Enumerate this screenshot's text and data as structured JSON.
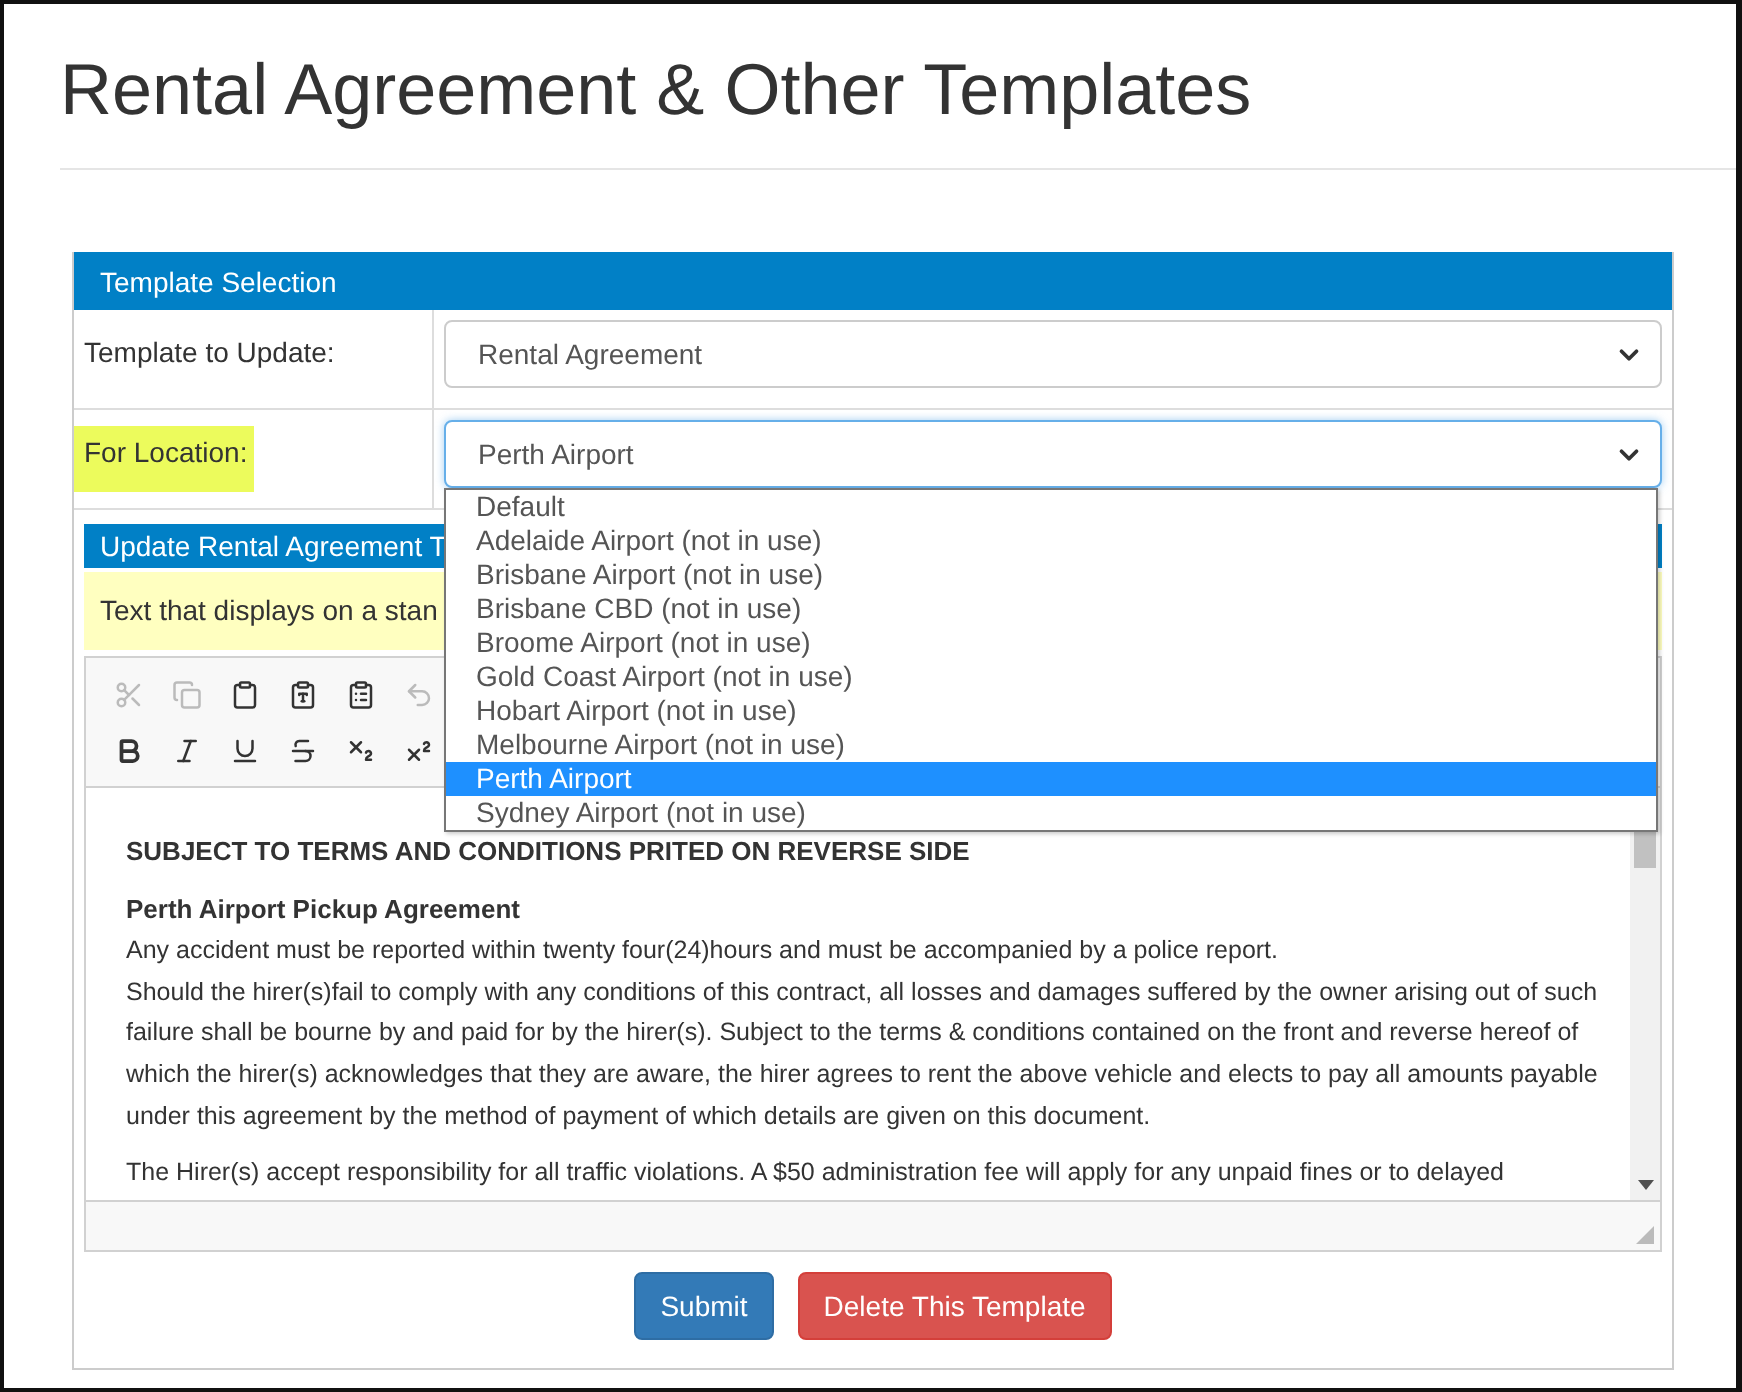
{
  "page_title": "Rental Agreement & Other Templates",
  "selection_panel": {
    "title": "Template Selection",
    "template_field": {
      "label": "Template to Update:",
      "value": "Rental Agreement"
    },
    "location_field": {
      "label": "For Location:",
      "highlighted": true,
      "value": "Perth Airport",
      "expanded": true,
      "options": [
        {
          "label": "Default",
          "selected": false
        },
        {
          "label": "Adelaide Airport (not in use)",
          "selected": false
        },
        {
          "label": "Brisbane Airport (not in use)",
          "selected": false
        },
        {
          "label": "Brisbane CBD (not in use)",
          "selected": false
        },
        {
          "label": "Broome Airport (not in use)",
          "selected": false
        },
        {
          "label": "Gold Coast Airport (not in use)",
          "selected": false
        },
        {
          "label": "Hobart Airport (not in use)",
          "selected": false
        },
        {
          "label": "Melbourne Airport (not in use)",
          "selected": false
        },
        {
          "label": "Perth Airport",
          "selected": true
        },
        {
          "label": "Sydney Airport (not in use)",
          "selected": false
        }
      ]
    }
  },
  "update_panel": {
    "title": "Update Rental Agreement T",
    "note": "Text that displays on a stan",
    "toolbar_rows": [
      [
        {
          "kind": "cut",
          "disabled": true
        },
        {
          "kind": "copy",
          "disabled": true
        },
        {
          "kind": "paste",
          "disabled": false
        },
        {
          "kind": "paste-text",
          "disabled": false
        },
        {
          "kind": "paste-word",
          "disabled": false
        },
        {
          "kind": "undo",
          "disabled": true
        }
      ],
      [
        {
          "kind": "bold",
          "disabled": false
        },
        {
          "kind": "italic",
          "disabled": false
        },
        {
          "kind": "underline",
          "disabled": false
        },
        {
          "kind": "strike",
          "disabled": false
        },
        {
          "kind": "subscript",
          "disabled": false
        },
        {
          "kind": "superscript",
          "disabled": false
        }
      ]
    ],
    "content": {
      "heading": "SUBJECT TO TERMS AND CONDITIONS PRITED ON REVERSE SIDE",
      "subheading": "Perth Airport Pickup Agreement",
      "paragraph": "Any accident must be reported within twenty four(24)hours and must be accompanied by a police report.\nShould the hirer(s)fail to comply with any conditions of this contract, all losses and damages suffered by the owner arising out of such failure shall be bourne by and paid for by the hirer(s). Subject to the terms & conditions contained on the front and reverse hereof of which the hirer(s) acknowledges that they are aware, the hirer agrees to rent the above vehicle and elects to pay all amounts payable under this agreement by the method of payment of which details are given on this document.",
      "next_paragraph": "The Hirer(s) accept responsibility for all traffic violations. A $50 administration fee will apply for any unpaid fines or to delayed"
    }
  },
  "buttons": [
    {
      "label": "Submit",
      "kind": "primary"
    },
    {
      "label": "Delete This Template",
      "kind": "danger"
    }
  ]
}
